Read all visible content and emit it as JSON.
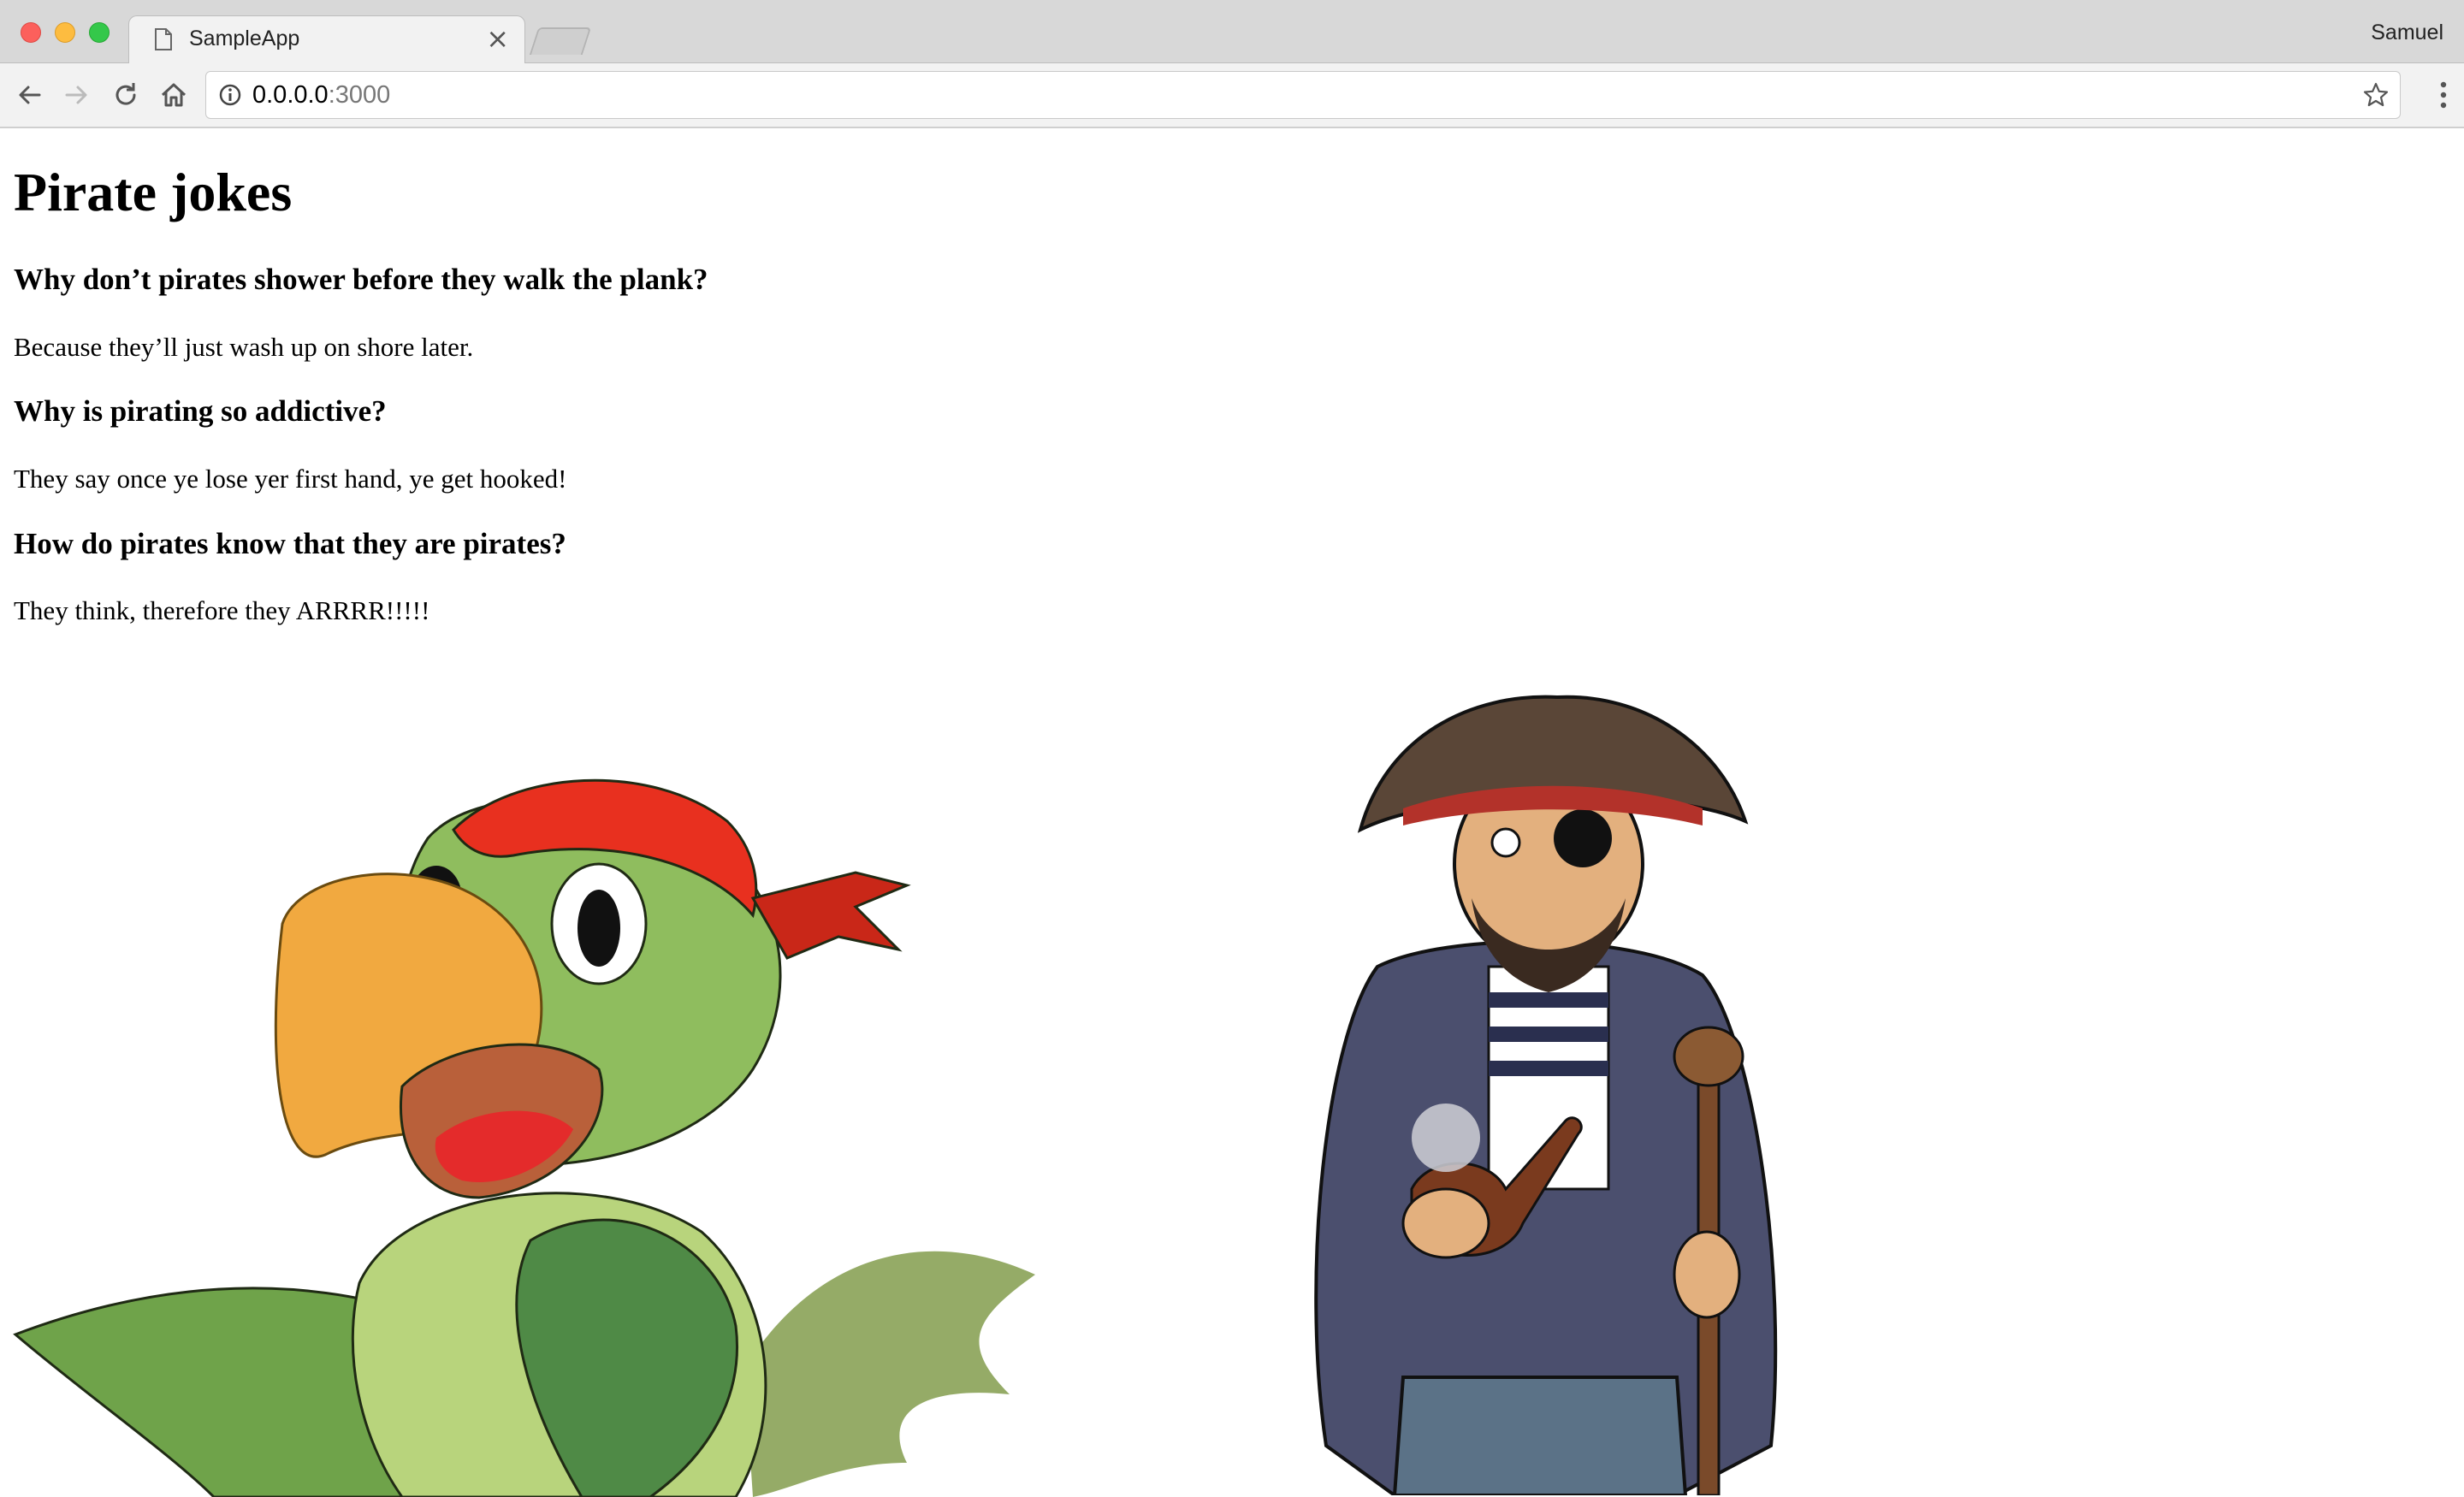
{
  "browser": {
    "tab_title": "SampleApp",
    "tab_close": "×",
    "profile_name": "Samuel",
    "url_host": "0.0.0.0",
    "url_port": ":3000"
  },
  "page": {
    "title": "Pirate jokes",
    "jokes": [
      {
        "question": "Why don’t pirates shower before they walk the plank?",
        "answer": "Because they’ll just wash up on shore later."
      },
      {
        "question": "Why is pirating so addictive?",
        "answer": "They say once ye lose yer first hand, ye get hooked!"
      },
      {
        "question": "How do pirates know that they are pirates?",
        "answer": "They think, therefore they ARRRR!!!!!"
      }
    ]
  },
  "icons": {
    "back": "arrow-left-icon",
    "forward": "arrow-right-icon",
    "reload": "reload-icon",
    "home": "home-icon",
    "info": "info-icon",
    "bookmark": "star-icon",
    "menu": "kebab-menu-icon"
  }
}
